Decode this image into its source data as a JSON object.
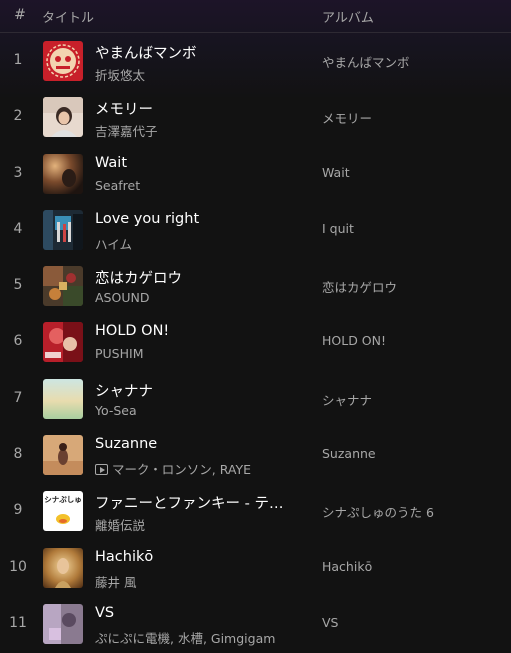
{
  "header": {
    "num_label": "#",
    "title_label": "タイトル",
    "album_label": "アルバム"
  },
  "tracks": [
    {
      "num": "1",
      "title": "やまんばマンボ",
      "artist": "折坂悠太",
      "album": "やまんばマンボ",
      "art_icon": "album-art"
    },
    {
      "num": "2",
      "title": "メモリー",
      "artist": "吉澤嘉代子",
      "album": "メモリー",
      "art_icon": "album-art"
    },
    {
      "num": "3",
      "title": "Wait",
      "artist": "Seafret",
      "album": "Wait",
      "art_icon": "album-art"
    },
    {
      "num": "4",
      "title": "Love you right",
      "artist": "ハイム",
      "album": "I quit",
      "art_icon": "album-art"
    },
    {
      "num": "5",
      "title": "恋はカゲロウ",
      "artist": "ASOUND",
      "album": "恋はカゲロウ",
      "art_icon": "album-art"
    },
    {
      "num": "6",
      "title": "HOLD ON!",
      "artist": "PUSHIM",
      "album": "HOLD ON!",
      "art_icon": "album-art"
    },
    {
      "num": "7",
      "title": "シャナナ",
      "artist": "Yo-Sea",
      "album": "シャナナ",
      "art_icon": "album-art"
    },
    {
      "num": "8",
      "title": "Suzanne",
      "artist": "マーク・ロンソン, RAYE",
      "album": "Suzanne",
      "art_icon": "album-art",
      "artist_icon": "video-icon"
    },
    {
      "num": "9",
      "title": "ファニーとファンキー - テ…",
      "artist": "離婚伝説",
      "album": "シナぷしゅのうた 6",
      "art_icon": "album-art",
      "art_text": "シナぷしゅ"
    },
    {
      "num": "10",
      "title": "Hachikō",
      "artist": "藤井 風",
      "album": "Hachikō",
      "art_icon": "album-art"
    },
    {
      "num": "11",
      "title": "VS",
      "artist": "ぷにぷに電機, 水槽, Gimgigam",
      "album": "VS",
      "art_icon": "album-art"
    }
  ],
  "colors": {
    "background": "#121212",
    "text_primary": "#ffffff",
    "text_secondary": "#a7a7a7"
  }
}
